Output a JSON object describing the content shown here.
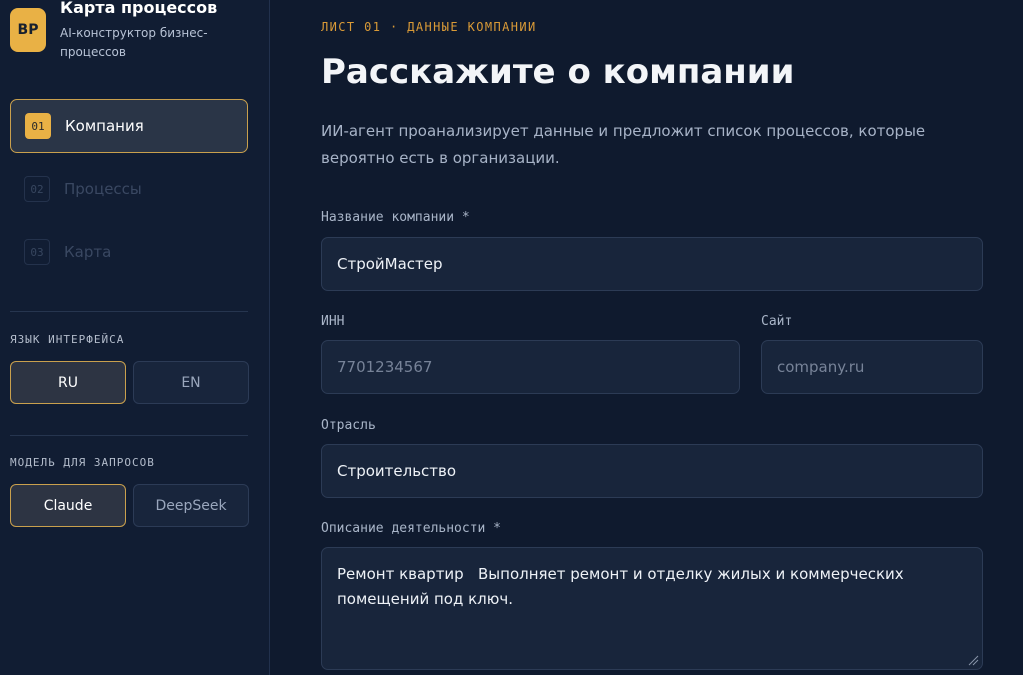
{
  "brand": {
    "logo_text": "BP",
    "title": "Карта процессов",
    "subtitle": "AI-конструктор бизнес-процессов"
  },
  "steps": [
    {
      "num": "01",
      "label": "Компания",
      "active": true
    },
    {
      "num": "02",
      "label": "Процессы",
      "active": false
    },
    {
      "num": "03",
      "label": "Карта",
      "active": false
    }
  ],
  "language": {
    "label": "ЯЗЫК ИНТЕРФЕЙСА",
    "options": [
      "RU",
      "EN"
    ],
    "selected": "RU"
  },
  "model": {
    "label": "МОДЕЛЬ ДЛЯ ЗАПРОСОВ",
    "options": [
      "Claude",
      "DeepSeek"
    ],
    "selected": "Claude"
  },
  "main": {
    "eyebrow": "ЛИСТ 01 · ДАННЫЕ КОМПАНИИ",
    "title": "Расскажите о компании",
    "lead": "ИИ-агент проанализирует данные и предложит список процессов, которые вероятно есть в организации."
  },
  "form": {
    "company_name": {
      "label": "Название компании *",
      "value": "СтройМастер"
    },
    "inn": {
      "label": "ИНН",
      "placeholder": "7701234567"
    },
    "site": {
      "label": "Сайт",
      "placeholder": "company.ru"
    },
    "industry": {
      "label": "Отрасль",
      "value": "Строительство"
    },
    "description": {
      "label": "Описание деятельности *",
      "value": "Ремонт квартир   Выполняет ремонт и отделку жилых и коммерческих помещений под ключ."
    }
  },
  "colors": {
    "accent": "#e9b145",
    "background": "#0f1a2e",
    "sidebar": "#111d33"
  }
}
